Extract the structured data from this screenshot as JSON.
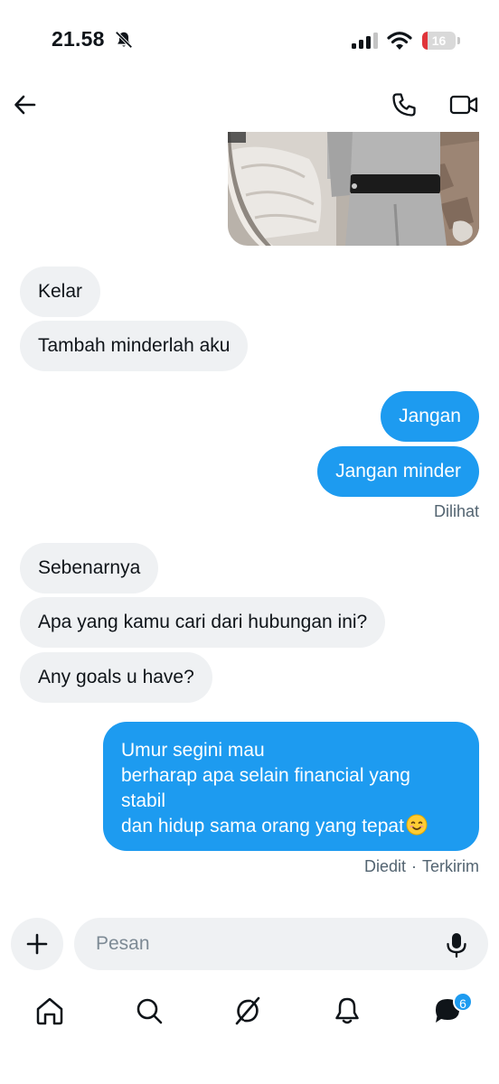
{
  "status_bar": {
    "time": "21.58",
    "battery_level": "16",
    "battery_fraction": 0.16,
    "icons": [
      "bell-off-icon",
      "signal-icon",
      "wifi-icon",
      "battery-icon"
    ]
  },
  "header": {
    "icons": [
      "back-arrow-icon",
      "phone-icon",
      "video-camera-icon"
    ]
  },
  "messages": [
    {
      "type": "image",
      "direction": "out",
      "alt": ""
    },
    {
      "type": "text",
      "direction": "in",
      "text": "Kelar"
    },
    {
      "type": "text",
      "direction": "in",
      "text": "Tambah minderlah aku"
    },
    {
      "type": "text",
      "direction": "out",
      "text": "Jangan"
    },
    {
      "type": "text",
      "direction": "out",
      "text": "Jangan minder"
    },
    {
      "type": "text",
      "direction": "in",
      "text": "Sebenarnya"
    },
    {
      "type": "text",
      "direction": "in",
      "text": "Apa yang kamu cari dari hubungan ini?"
    },
    {
      "type": "text",
      "direction": "in",
      "text": "Any goals u have?"
    },
    {
      "type": "text",
      "direction": "out",
      "lines": [
        "Umur segini mau",
        "berharap apa selain financial yang",
        "stabil",
        "dan hidup sama orang yang tepat"
      ],
      "emoji": "smiling-face-icon"
    }
  ],
  "meta": {
    "seen": "Dilihat",
    "edited": "Diedit",
    "separator": "·",
    "sent": "Terkirim"
  },
  "composer": {
    "placeholder": "Pesan",
    "value": ""
  },
  "bottom_nav": {
    "items": [
      "home-icon",
      "search-icon",
      "grok-icon",
      "notifications-bell-icon",
      "messages-icon"
    ],
    "messages_badge": "6"
  },
  "colors": {
    "accent": "#1d9bf0",
    "incoming_bubble": "#eff1f3",
    "meta_text": "#536471",
    "battery_low": "#e0343a"
  }
}
